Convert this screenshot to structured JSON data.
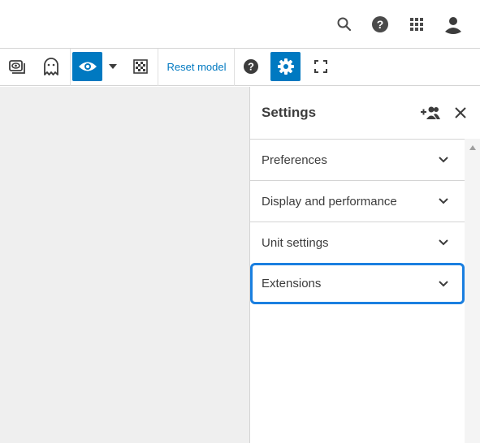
{
  "topbar": {
    "icons": [
      "search-icon",
      "help-icon",
      "apps-grid-icon",
      "user-avatar-icon"
    ]
  },
  "toolbar": {
    "items": [
      "3d-view-icon",
      "ghost-icon",
      "eye-icon",
      "dropdown-caret-icon",
      "checkerboard-icon"
    ],
    "reset_label": "Reset model",
    "right_items": [
      "help-icon",
      "gear-icon",
      "fullscreen-icon"
    ]
  },
  "panel": {
    "title": "Settings",
    "header_icons": [
      "add-user-icon",
      "close-icon"
    ],
    "sections": [
      {
        "label": "Preferences"
      },
      {
        "label": "Display and performance"
      },
      {
        "label": "Unit settings"
      },
      {
        "label": "Extensions"
      }
    ]
  },
  "colors": {
    "accent": "#0079c1",
    "focus_outline": "#1a7fe0",
    "viewport_bg": "#efefef"
  }
}
